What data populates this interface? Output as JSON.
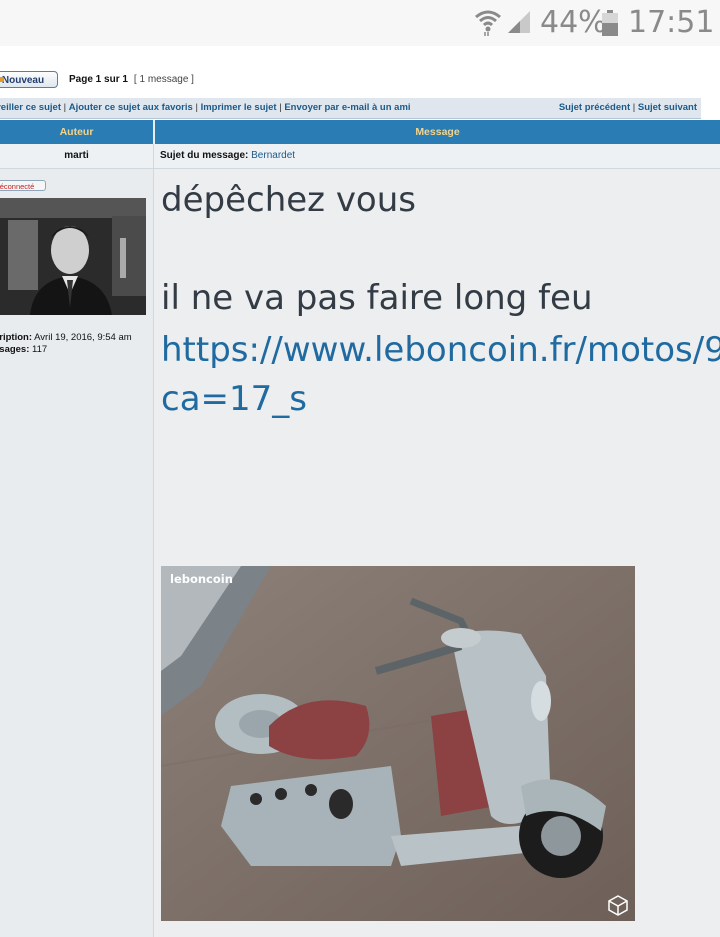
{
  "status_bar": {
    "battery_percent": "44%",
    "time": "17:51",
    "icons": [
      "wifi-icon",
      "cell-signal-icon",
      "battery-icon"
    ]
  },
  "forum": {
    "new_button": "Nouveau",
    "page_info": "Page 1 sur 1",
    "message_count": "[ 1 message ]",
    "links_left": [
      "urveiller ce sujet",
      "Ajouter ce sujet aux favoris",
      "Imprimer le sujet",
      "Envoyer par e-mail à un ami"
    ],
    "links_right": [
      "Sujet précédent",
      "Sujet suivant"
    ],
    "columns": {
      "author": "Auteur",
      "message": "Message"
    },
    "post": {
      "author": "marti",
      "subject_label": "Sujet du message:",
      "subject": "Bernardet",
      "status_badge": "éconnecté",
      "registration_label": "cription:",
      "registration_date": "Avril 19, 2016, 9:54 am",
      "messages_label": "ssages:",
      "messages_count": "117",
      "body_line1": "dépêchez vous",
      "body_line2": "il ne va pas faire long feu",
      "link_line1": "https://www.leboncoin.fr/motos/9",
      "link_line2": "ca=17_s",
      "image_brand": "leboncoin"
    }
  },
  "colors": {
    "header_blue": "#2a7db4",
    "header_text": "#f3d48c",
    "link_blue": "#1f6aa0"
  }
}
